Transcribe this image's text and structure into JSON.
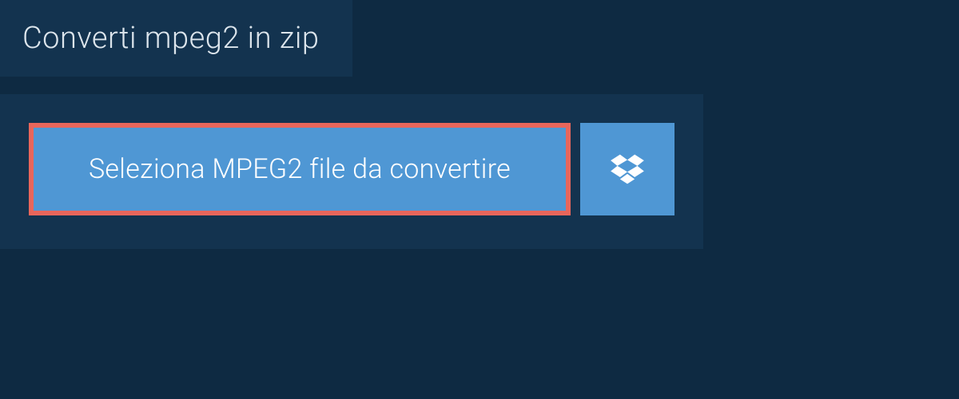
{
  "header": {
    "title": "Converti mpeg2 in zip"
  },
  "actions": {
    "select_file_label": "Seleziona MPEG2 file da convertire",
    "dropbox_icon_name": "dropbox-icon"
  },
  "colors": {
    "background": "#0e2a42",
    "panel": "#13334f",
    "button": "#4f97d4",
    "highlight_border": "#e8665b",
    "text_light": "#dce5ec",
    "text_white": "#ffffff"
  }
}
